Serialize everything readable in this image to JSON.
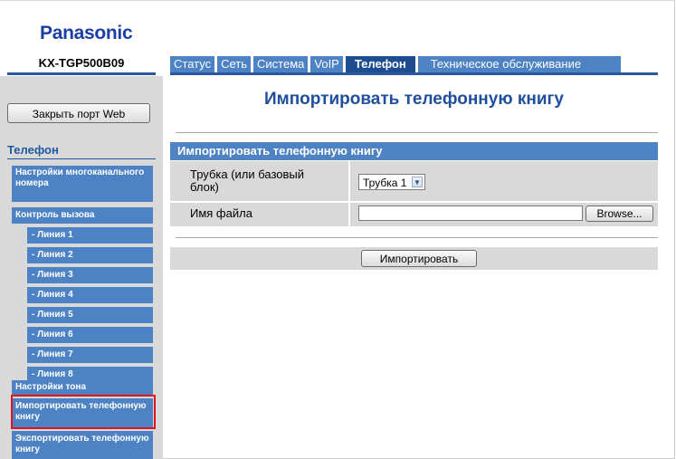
{
  "header": {
    "brand": "Panasonic",
    "model": "KX-TGP500B09"
  },
  "tabs": [
    {
      "label": "Статус"
    },
    {
      "label": "Сеть"
    },
    {
      "label": "Система"
    },
    {
      "label": "VoIP"
    },
    {
      "label": "Телефон",
      "active": true
    },
    {
      "label": "Техническое обслуживание"
    }
  ],
  "sidebar": {
    "close_port_label": "Закрыть порт Web",
    "section_title": "Телефон",
    "items": [
      {
        "label": "Настройки многоканального номера"
      },
      {
        "label": "Контроль вызова"
      },
      {
        "label": "- Линия 1"
      },
      {
        "label": "- Линия 2"
      },
      {
        "label": "- Линия 3"
      },
      {
        "label": "- Линия 4"
      },
      {
        "label": "- Линия 5"
      },
      {
        "label": "- Линия 6"
      },
      {
        "label": "- Линия 7"
      },
      {
        "label": "- Линия 8"
      },
      {
        "label": "Настройки тона"
      },
      {
        "label": "Импортировать телефонную книгу",
        "selected": true
      },
      {
        "label": "Экспортировать телефонную книгу"
      }
    ]
  },
  "main": {
    "title": "Импортировать телефонную книгу",
    "table_header": "Импортировать телефонную книгу",
    "handset_label": "Трубка (или базовый блок)",
    "handset_value": "Трубка 1",
    "filename_label": "Имя файла",
    "filename_value": "",
    "browse_label": "Browse...",
    "import_label": "Импортировать"
  },
  "colors": {
    "brand": "#1a3ea8",
    "tab": "#4d82c4",
    "tab_active": "#1f4d91",
    "highlight": "#e0141e"
  }
}
